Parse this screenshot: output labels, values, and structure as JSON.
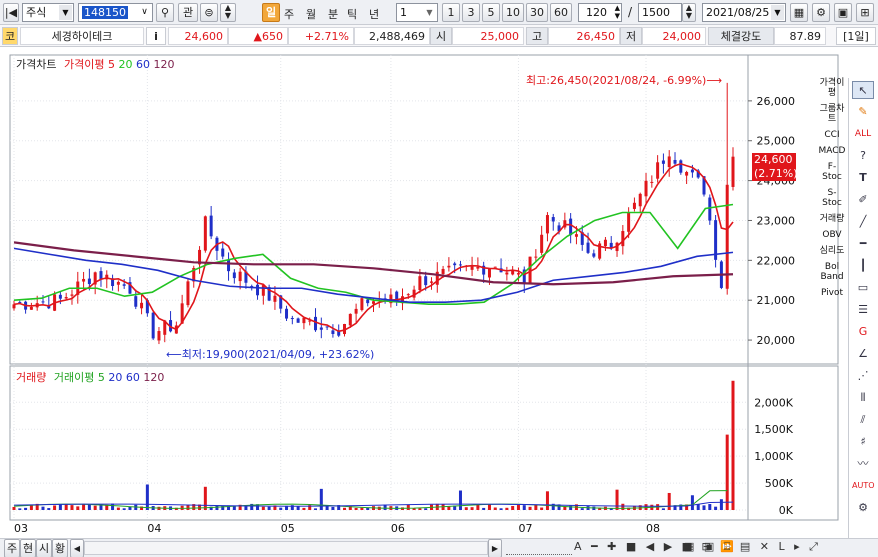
{
  "toolbar": {
    "market": "주식",
    "code": "148150",
    "btn_watch": "관",
    "period_day": "일",
    "period_week": "주",
    "period_month": "월",
    "period_minute": "분",
    "period_tick": "틱",
    "period_year": "년",
    "interval": "1",
    "quick_1": "1",
    "quick_3": "3",
    "quick_5": "5",
    "quick_10": "10",
    "quick_30": "30",
    "quick_60": "60",
    "count": "120",
    "separator": "/",
    "total": "1500",
    "date": "2021/08/25"
  },
  "quote": {
    "market_badge": "코",
    "name": "세경하이테크",
    "info_badge": "i",
    "price": "24,600",
    "change": "▲650",
    "change_pct": "+2.71%",
    "volume": "2,488,469",
    "open_label": "시",
    "open": "25,000",
    "high_label": "고",
    "high": "26,450",
    "low_label": "저",
    "low": "24,000",
    "strength_label": "체결강도",
    "strength": "87.89",
    "period_badge": "[1일]"
  },
  "price_legend": {
    "title": "가격차트",
    "ma_label": "가격이평",
    "ma5": "5",
    "ma20": "20",
    "ma60": "60",
    "ma120": "120"
  },
  "volume_legend": {
    "title": "거래량",
    "ma_label": "거래이평",
    "ma5": "5",
    "ma20": "20",
    "ma60": "60",
    "ma120": "120"
  },
  "annotations": {
    "high": "최고:26,450(2021/08/24, -6.99%)",
    "low": "최저:19,900(2021/04/09, +23.62%)",
    "last_price": "24,600",
    "last_pct": "(2.71%)"
  },
  "indicators": [
    "가격이평",
    "그룹차트",
    "CCI",
    "MACD",
    "F-Stoc",
    "S-Stoc",
    "거래량",
    "OBV",
    "심리도",
    "Bol Band",
    "Pivot"
  ],
  "bottom_tabs": [
    "주",
    "현",
    "시",
    "황"
  ],
  "colors": {
    "up": "#e0161b",
    "down": "#1f2fc8",
    "ma5": "#e0161b",
    "ma20": "#22c322",
    "ma60": "#1f2fc8",
    "ma120": "#7b1f4a"
  },
  "chart_data": {
    "type": "candlestick",
    "price_axis": {
      "ticks": [
        20000,
        21000,
        22000,
        23000,
        24000,
        25000,
        26000
      ],
      "labels": [
        "20,000",
        "21,000",
        "22,000",
        "23,000",
        "24,000",
        "25,000",
        "26,000"
      ],
      "ylim": [
        19500,
        27000
      ]
    },
    "volume_axis": {
      "ticks": [
        0,
        500,
        1000,
        1500,
        2000
      ],
      "labels": [
        "0K",
        "500K",
        "1,000K",
        "1,500K",
        "2,000K"
      ],
      "ylim": [
        0,
        2600
      ]
    },
    "x_labels": [
      "03",
      "04",
      "05",
      "06",
      "07",
      "08"
    ],
    "x_label_index": [
      0,
      23,
      46,
      65,
      87,
      109
    ],
    "ohlc_start": [
      20800,
      21100,
      20700,
      20700,
      20550,
      21000
    ],
    "ohlc_end": [
      22550,
      22500,
      24900,
      24050,
      24600
    ],
    "candles_count": 125,
    "high_point": {
      "index": 123,
      "value": 26450
    },
    "low_point": {
      "index": 25,
      "value": 19900
    },
    "last_close": 24600,
    "ma": {
      "ma20": [
        21000,
        21050,
        21300,
        21300,
        21100,
        21200,
        21600,
        21900,
        22050,
        22150,
        21550,
        21300,
        21200,
        21000,
        20950,
        20900,
        20900,
        20950,
        21400,
        22050,
        22600,
        23000,
        23200,
        23200,
        22300,
        23300,
        23400
      ],
      "ma60": [
        22300,
        22150,
        22000,
        21900,
        21750,
        21500,
        21350,
        21300,
        21300,
        21150,
        21050,
        20950,
        20950,
        21000,
        21200,
        21500,
        21600,
        21700,
        21850,
        22100,
        22200
      ],
      "ma120": [
        22450,
        22250,
        22100,
        21950,
        21900,
        21900,
        21800,
        21650,
        21450,
        21400,
        21450,
        21600,
        21650
      ]
    }
  }
}
